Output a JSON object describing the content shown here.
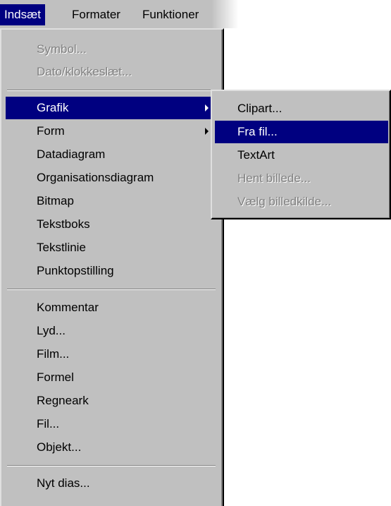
{
  "menubar": {
    "items": [
      {
        "label": "Indsæt",
        "active": true
      },
      {
        "label": "Formater",
        "active": false
      },
      {
        "label": "Funktioner",
        "active": false
      }
    ]
  },
  "menu": {
    "items": [
      {
        "label": "Symbol...",
        "disabled": true
      },
      {
        "label": "Dato/klokkeslæt...",
        "disabled": true
      },
      {
        "label": "Grafik",
        "highlighted": true,
        "submenu": true
      },
      {
        "label": "Form",
        "submenu": true
      },
      {
        "label": "Datadiagram"
      },
      {
        "label": "Organisationsdiagram"
      },
      {
        "label": "Bitmap"
      },
      {
        "label": "Tekstboks"
      },
      {
        "label": "Tekstlinie"
      },
      {
        "label": "Punktopstilling"
      },
      {
        "label": "Kommentar"
      },
      {
        "label": "Lyd..."
      },
      {
        "label": "Film..."
      },
      {
        "label": "Formel"
      },
      {
        "label": "Regneark"
      },
      {
        "label": "Fil..."
      },
      {
        "label": "Objekt..."
      },
      {
        "label": "Nyt dias..."
      }
    ]
  },
  "submenu": {
    "items": [
      {
        "label": "Clipart..."
      },
      {
        "label": "Fra fil...",
        "highlighted": true
      },
      {
        "label": "TextArt"
      },
      {
        "label": "Hent billede...",
        "disabled": true
      },
      {
        "label": "Vælg billedkilde...",
        "disabled": true
      }
    ]
  },
  "colors": {
    "menu_bg": "#c0c0c0",
    "highlight": "#000080",
    "highlight_text": "#ffffff",
    "disabled_text": "#808080"
  }
}
